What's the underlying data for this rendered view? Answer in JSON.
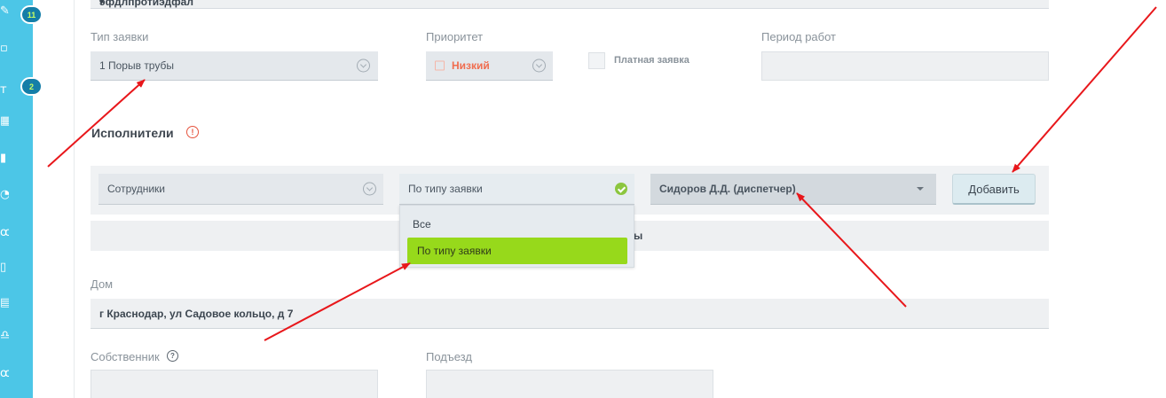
{
  "sidebar": {
    "badges": [
      "11",
      "2"
    ],
    "icons": [
      "edit-icon",
      "document-icon",
      "tag-icon",
      "calendar-icon",
      "list-icon",
      "clock-icon",
      "users-icon",
      "file-icon",
      "briefcase-icon",
      "scales-icon",
      "people-icon"
    ],
    "glyphs": [
      "✎",
      "▫",
      "т",
      "▦",
      "▮",
      "◔",
      "ꝏ",
      "▯",
      "▤",
      "♎",
      "ꝏ"
    ]
  },
  "form": {
    "description_value": "эфдлпротиэдфал",
    "request_type": {
      "label": "Тип заявки",
      "value": "1 Порыв трубы"
    },
    "priority": {
      "label": "Приоритет",
      "value": "Низкий"
    },
    "paid": {
      "label": "Платная заявка",
      "checked": false
    },
    "work_period": {
      "label": "Период работ",
      "value": ""
    },
    "executors": {
      "title": "Исполнители",
      "warning_glyph": "!",
      "employees_select": "Сотрудники",
      "filter_select": "По типу заявки",
      "person_select": "Сидоров Д.Д. (диспетчер)",
      "add_button": "Добавить",
      "band_text": "ы",
      "dropdown_options": [
        "Все",
        "По типу заявки"
      ],
      "dropdown_selected": "По типу заявки"
    },
    "house": {
      "label": "Дом",
      "value": "г Краснодар, ул Садовое кольцо, д 7"
    },
    "owner": {
      "label": "Собственник",
      "help_glyph": "?",
      "value": ""
    },
    "entrance": {
      "label": "Подъезд",
      "value": ""
    }
  },
  "colors": {
    "sidebar": "#4cc6e7",
    "badge": "#147ea8",
    "priority_low": "#f06d4f",
    "selected_option": "#97d91b",
    "annotation_arrow": "#e8171b"
  }
}
